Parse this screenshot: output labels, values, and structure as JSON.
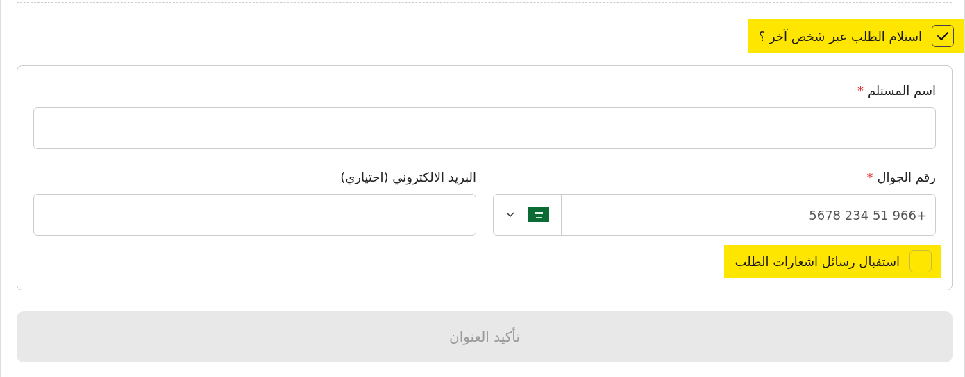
{
  "receive_by_other": {
    "label": "استلام الطلب عبر شخص آخر ؟",
    "checked": true
  },
  "recipient_form": {
    "fields": [
      {
        "kind": "text",
        "label": "اسم المستلم",
        "required_mark": "*"
      },
      {
        "kind": "phone",
        "label": "رقم الجوال",
        "required_mark": "*",
        "placeholder": "+966 51 234 5678"
      },
      {
        "kind": "text",
        "label": "البريد الالكتروني (اختياري)"
      }
    ],
    "notifications": {
      "label": "استقبال رسائل اشعارات الطلب",
      "checked": false
    }
  },
  "confirm_button": {
    "label": "تأكيد العنوان",
    "disabled": true
  }
}
